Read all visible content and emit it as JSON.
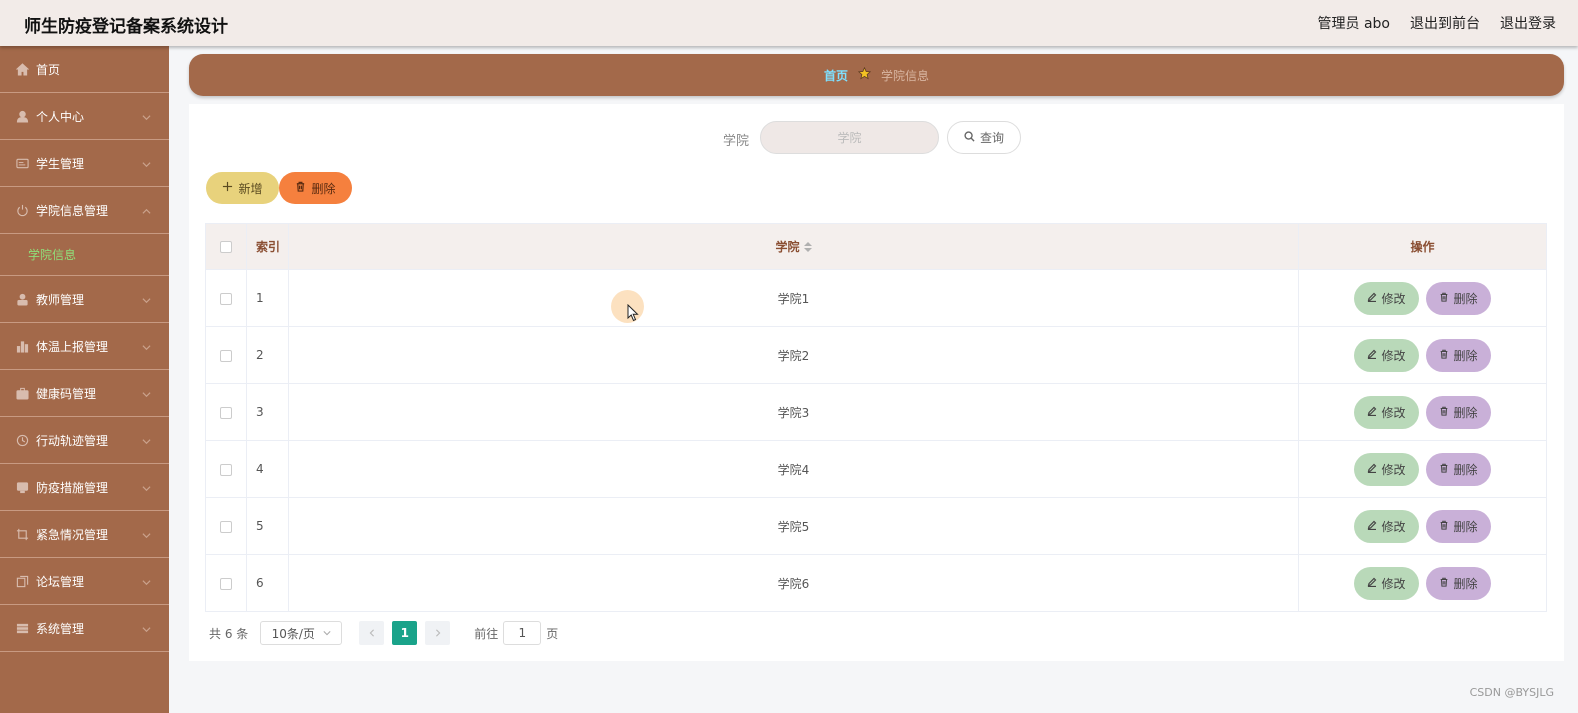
{
  "header": {
    "title": "师生防疫登记备案系统设计",
    "links": [
      "管理员 abo",
      "退出到前台",
      "退出登录"
    ]
  },
  "sidebar": {
    "items": [
      {
        "label": "首页",
        "icon": "home-icon"
      },
      {
        "label": "个人中心",
        "icon": "user-icon"
      },
      {
        "label": "学生管理",
        "icon": "id-card-icon"
      },
      {
        "label": "学院信息管理",
        "icon": "power-icon",
        "sub": "学院信息"
      },
      {
        "label": "教师管理",
        "icon": "teacher-icon"
      },
      {
        "label": "体温上报管理",
        "icon": "bar-chart-icon"
      },
      {
        "label": "健康码管理",
        "icon": "briefcase-icon"
      },
      {
        "label": "行动轨迹管理",
        "icon": "clock-icon"
      },
      {
        "label": "防疫措施管理",
        "icon": "monitor-icon"
      },
      {
        "label": "紧急情况管理",
        "icon": "crop-icon"
      },
      {
        "label": "论坛管理",
        "icon": "copy-icon"
      },
      {
        "label": "系统管理",
        "icon": "menu-icon"
      }
    ]
  },
  "breadcrumb": {
    "home": "首页",
    "current": "学院信息"
  },
  "search": {
    "label": "学院",
    "placeholder": "学院",
    "button": "查询"
  },
  "actions": {
    "add": "新增",
    "delete": "删除"
  },
  "table": {
    "headers": {
      "index": "索引",
      "name": "学院",
      "ops": "操作"
    },
    "edit_label": "修改",
    "delete_label": "删除",
    "rows": [
      {
        "index": "1",
        "name": "学院1"
      },
      {
        "index": "2",
        "name": "学院2"
      },
      {
        "index": "3",
        "name": "学院3"
      },
      {
        "index": "4",
        "name": "学院4"
      },
      {
        "index": "5",
        "name": "学院5"
      },
      {
        "index": "6",
        "name": "学院6"
      }
    ]
  },
  "pagination": {
    "total": "共 6 条",
    "page_size": "10条/页",
    "current": "1",
    "goto_prefix": "前往",
    "goto_value": "1",
    "goto_suffix": "页"
  },
  "watermark": "CSDN @BYSJLG",
  "colors": {
    "sidebar": "#a3694a",
    "accent_green": "#1aa38a",
    "add": "#e8d27c",
    "delete": "#f5803e"
  }
}
